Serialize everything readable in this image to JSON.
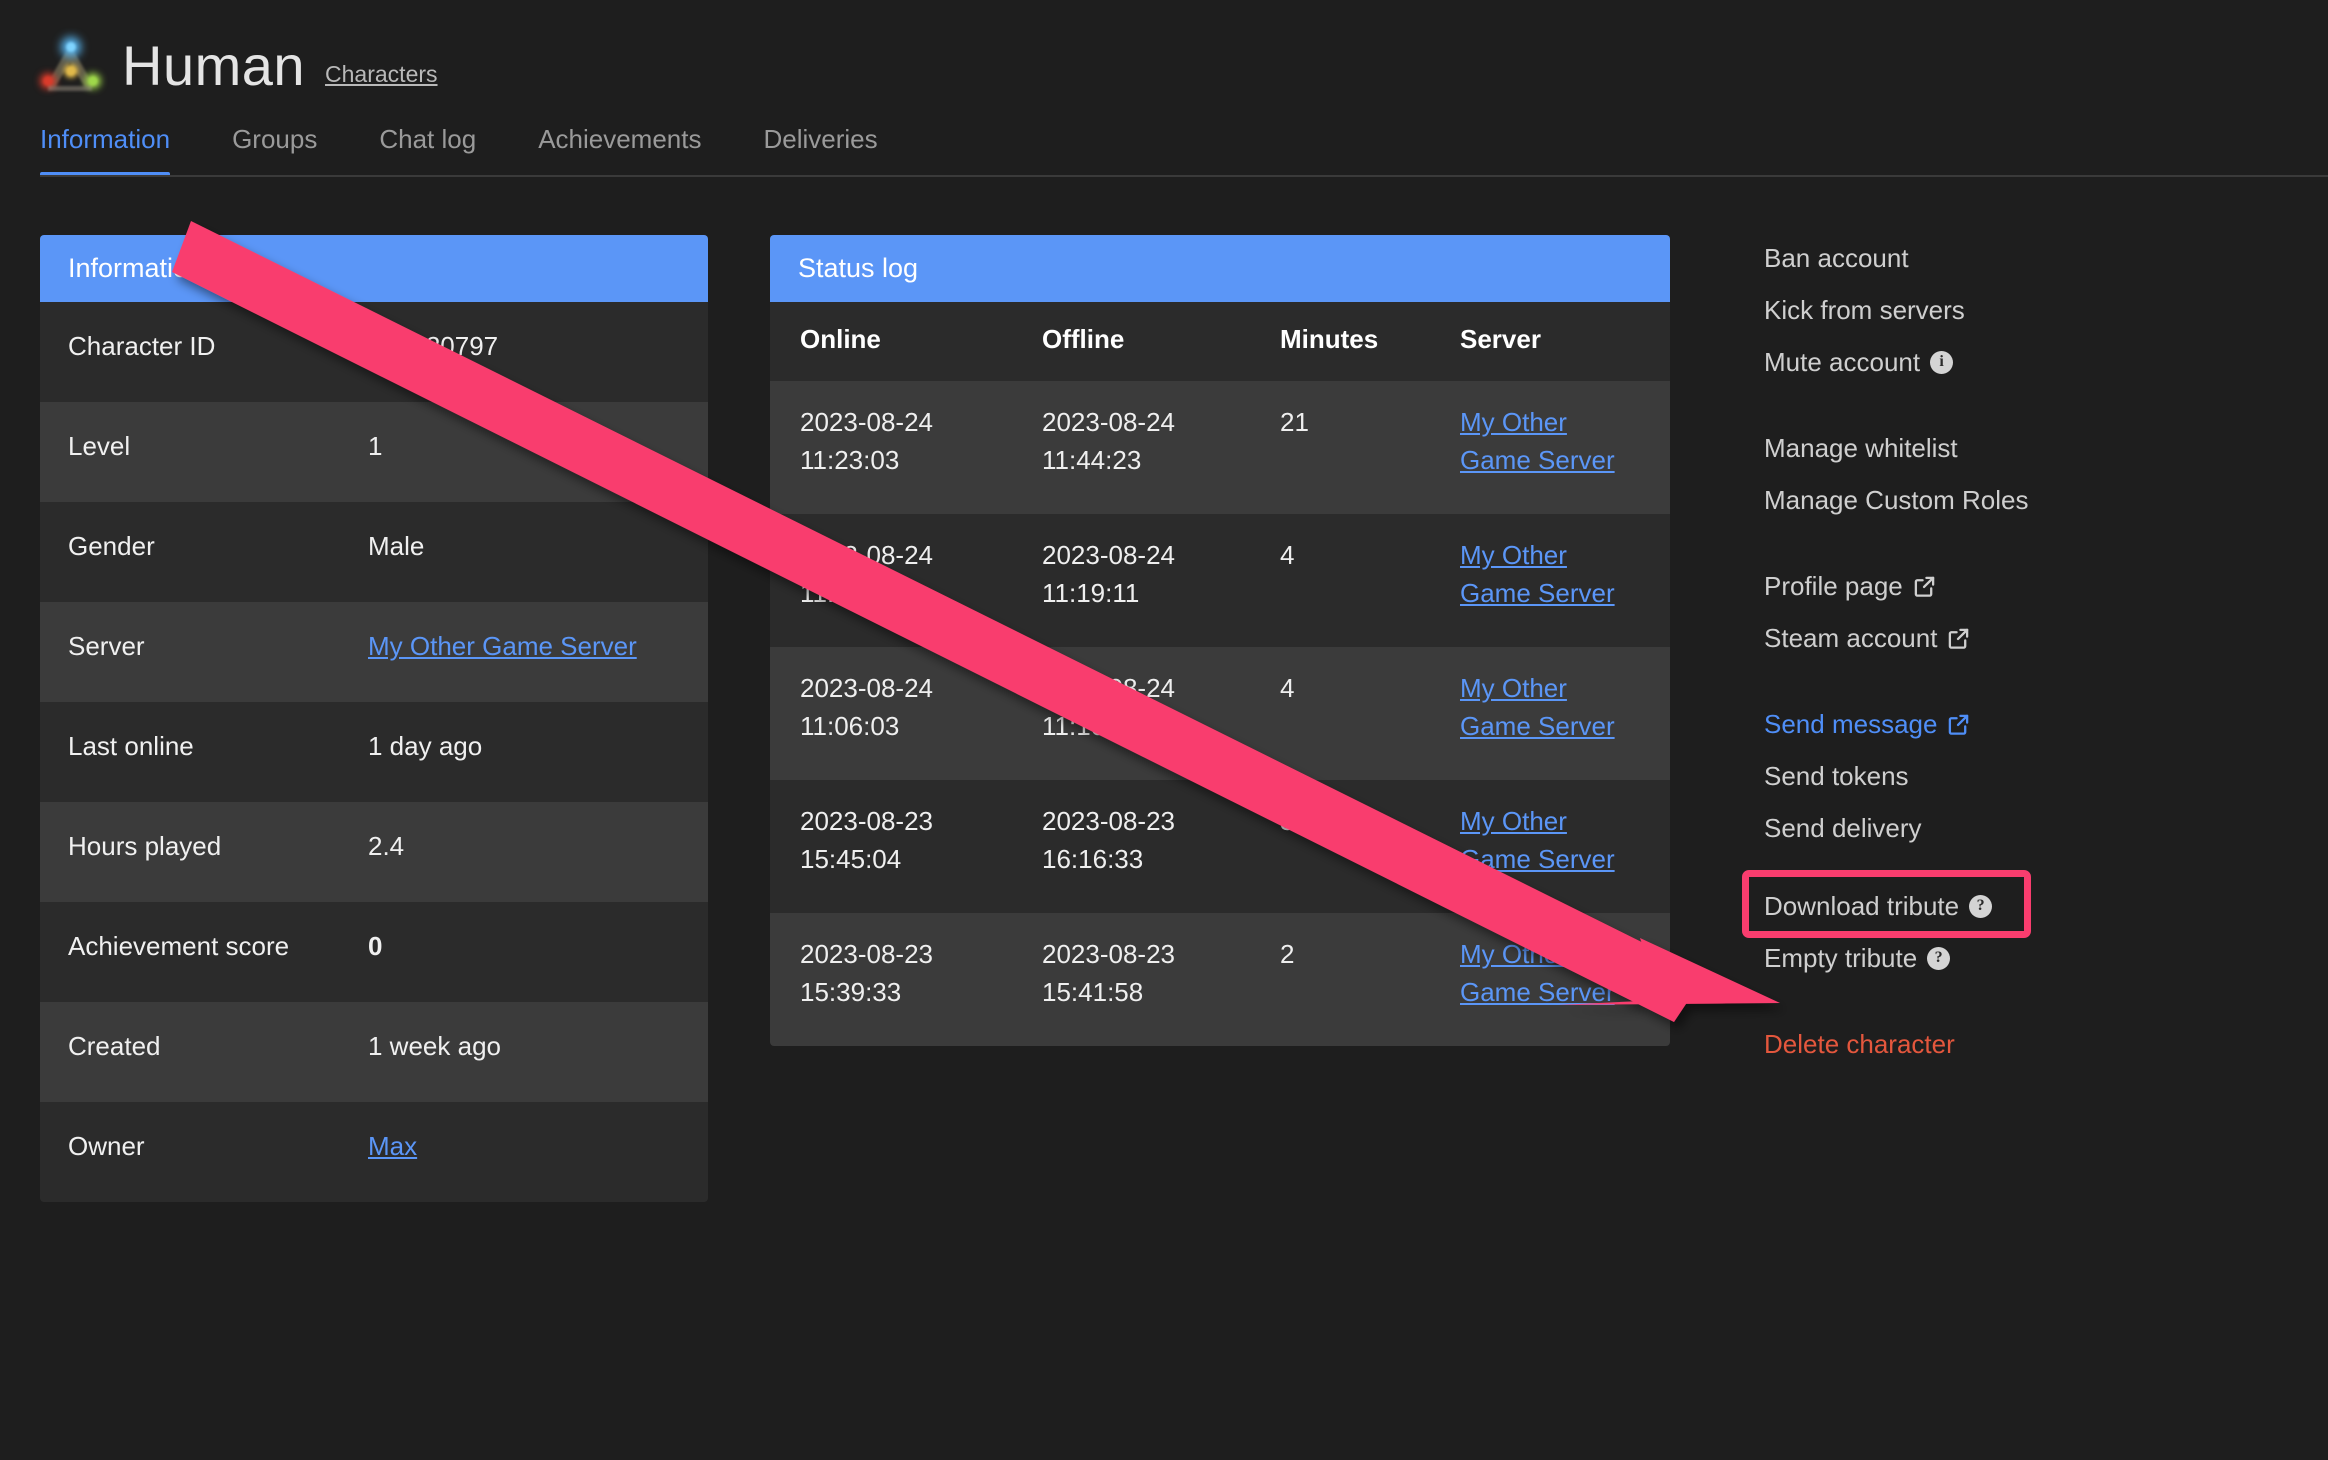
{
  "header": {
    "logo_icon": "ark-logo-icon",
    "title": "Human",
    "breadcrumb": "Characters"
  },
  "tabs": [
    {
      "label": "Information",
      "active": true
    },
    {
      "label": "Groups",
      "active": false
    },
    {
      "label": "Chat log",
      "active": false
    },
    {
      "label": "Achievements",
      "active": false
    },
    {
      "label": "Deliveries",
      "active": false
    }
  ],
  "information_card": {
    "title": "Information",
    "rows": [
      {
        "label": "Character ID",
        "value": "755920797",
        "type": "text"
      },
      {
        "label": "Level",
        "value": "1",
        "type": "text"
      },
      {
        "label": "Gender",
        "value": "Male",
        "type": "text"
      },
      {
        "label": "Server",
        "value": "My Other Game Server",
        "type": "link"
      },
      {
        "label": "Last online",
        "value": "1 day ago",
        "type": "text"
      },
      {
        "label": "Hours played",
        "value": "2.4",
        "type": "text"
      },
      {
        "label": "Achievement score",
        "value": "0",
        "type": "bold"
      },
      {
        "label": "Created",
        "value": "1 week ago",
        "type": "text"
      },
      {
        "label": "Owner",
        "value": "Max",
        "type": "link"
      }
    ]
  },
  "status_log_card": {
    "title": "Status log",
    "columns": [
      "Online",
      "Offline",
      "Minutes",
      "Server"
    ],
    "rows": [
      {
        "online_date": "2023-08-24",
        "online_time": "11:23:03",
        "offline_date": "2023-08-24",
        "offline_time": "11:44:23",
        "minutes": "21",
        "server": "My Other Game Server"
      },
      {
        "online_date": "2023-08-24",
        "online_time": "11:14:33",
        "offline_date": "2023-08-24",
        "offline_time": "11:19:11",
        "minutes": "4",
        "server": "My Other Game Server"
      },
      {
        "online_date": "2023-08-24",
        "online_time": "11:06:03",
        "offline_date": "2023-08-24",
        "offline_time": "11:10:54",
        "minutes": "4",
        "server": "My Other Game Server"
      },
      {
        "online_date": "2023-08-23",
        "online_time": "15:45:04",
        "offline_date": "2023-08-23",
        "offline_time": "16:16:33",
        "minutes": "31",
        "server": "My Other Game Server"
      },
      {
        "online_date": "2023-08-23",
        "online_time": "15:39:33",
        "offline_date": "2023-08-23",
        "offline_time": "15:41:58",
        "minutes": "2",
        "server": "My Other Game Server"
      }
    ]
  },
  "actions": {
    "ban_account": "Ban account",
    "kick_from_servers": "Kick from servers",
    "mute_account": "Mute account",
    "mute_info_icon": "info-icon",
    "manage_whitelist": "Manage whitelist",
    "manage_custom_roles": "Manage Custom Roles",
    "profile_page": "Profile page",
    "profile_ext_icon": "external-link-icon",
    "steam_account": "Steam account",
    "steam_ext_icon": "external-link-icon",
    "send_message": "Send message",
    "send_message_ext_icon": "external-link-icon",
    "send_tokens": "Send tokens",
    "send_delivery": "Send delivery",
    "download_tribute": "Download tribute",
    "download_tribute_help_icon": "help-icon",
    "empty_tribute": "Empty tribute",
    "empty_tribute_help_icon": "help-icon",
    "delete_character": "Delete character"
  },
  "annotation": {
    "arrow_icon": "pointer-arrow-icon",
    "highlight_target": "Download tribute",
    "color": "#f93d6e"
  },
  "colors": {
    "accent_blue": "#5b96f7",
    "tab_active": "#4f8ef7",
    "danger_red": "#e4573d",
    "annotation_pink": "#f93d6e",
    "background": "#1e1e1e",
    "row_dark": "#2b2b2b",
    "row_light": "#3b3b3b"
  }
}
